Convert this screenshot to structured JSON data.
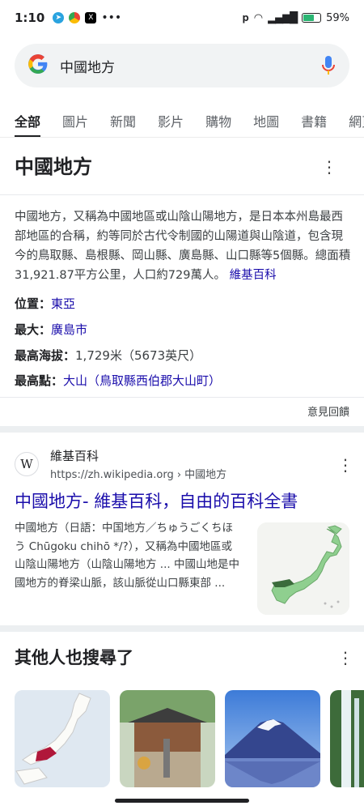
{
  "status": {
    "time": "1:10",
    "battery": "59%",
    "battery_level": 0.59
  },
  "search": {
    "query": "中國地方",
    "logo": "G"
  },
  "tabs": [
    "全部",
    "圖片",
    "新聞",
    "影片",
    "購物",
    "地圖",
    "書籍",
    "網頁"
  ],
  "knowledge_panel": {
    "title": "中國地方",
    "description": "中國地方，又稱為中國地區或山陰山陽地方，是日本本州島最西部地區的合稱，約等同於古代令制國的山陽道與山陰道，包含現今的鳥取縣、島根縣、岡山縣、廣島縣、山口縣等5個縣。總面積31,921.87平方公里，人口約729萬人。",
    "source_link": "維基百科",
    "facts": [
      {
        "key": "位置：",
        "value": "東亞",
        "link": true
      },
      {
        "key": "最大：",
        "value": "廣島市",
        "link": true
      },
      {
        "key": "最高海拔：",
        "value": "1,729米（5673英尺）",
        "link": false
      },
      {
        "key": "最高點：",
        "value": "大山（鳥取縣西伯郡大山町）",
        "link": true
      }
    ],
    "feedback": "意見回饋"
  },
  "result": {
    "site_name": "維基百科",
    "url": "https://zh.wikipedia.org › 中國地方",
    "title": "中國地方- 維基百科，自由的百科全書",
    "snippet": "中國地方（日語：中国地方／ちゅうごくちほう Chūgoku chihō */?），又稱為中國地區或山陰山陽地方（山陰山陽地方 ... 中國山地是中國地方的脊梁山脈，該山脈從山口縣東部 ..."
  },
  "others": {
    "heading": "其他人也搜尋了"
  },
  "colors": {
    "link": "#1a0dab",
    "search_bg": "#f1f3f4",
    "map_land": "#8fcf8f",
    "highlight": "#3b6b3b"
  }
}
